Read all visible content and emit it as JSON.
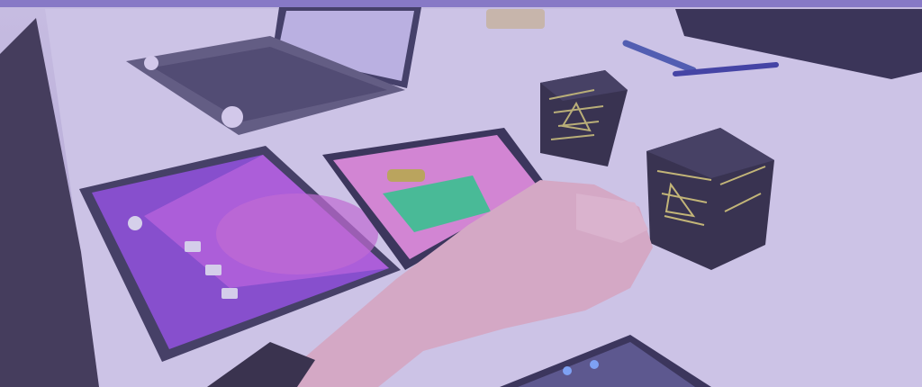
{
  "image": {
    "alt": "",
    "tint_color": "#7a5fbe",
    "objects": [
      "laptop-icon",
      "tablet-icon",
      "cube-icon",
      "pen-icon",
      "hand-icon",
      "phone-icon"
    ]
  }
}
